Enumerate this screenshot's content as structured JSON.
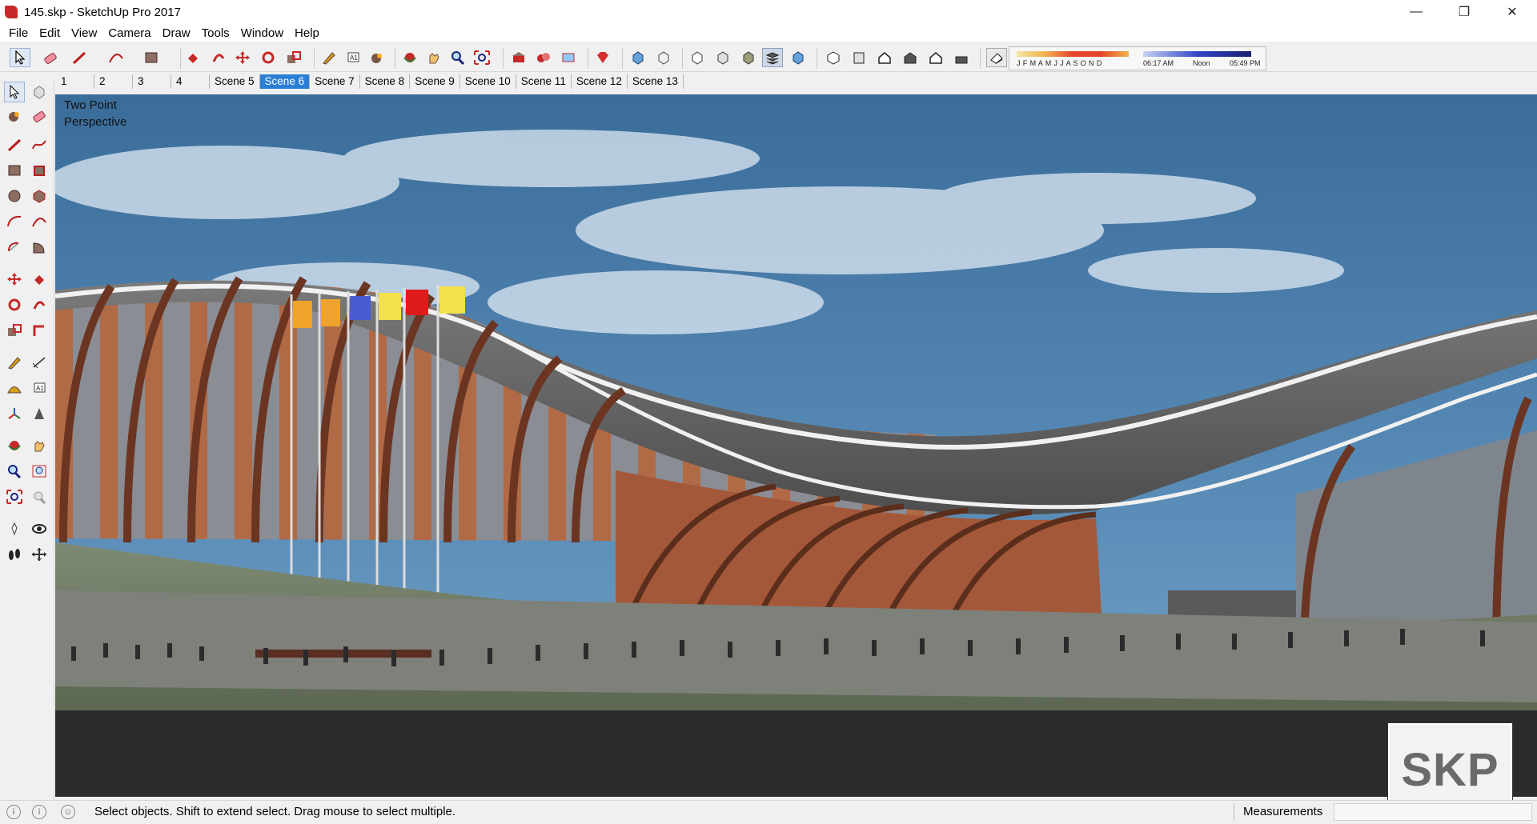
{
  "window": {
    "title": "145.skp - SketchUp Pro 2017",
    "minimize": "—",
    "restore": "❐",
    "close": "✕"
  },
  "menu": [
    "File",
    "Edit",
    "View",
    "Camera",
    "Draw",
    "Tools",
    "Window",
    "Help"
  ],
  "shadow_settings": {
    "months": "J F M A M J J A S O N D",
    "time_start": "06:17 AM",
    "time_mid": "Noon",
    "time_end": "05:49 PM"
  },
  "scenes": {
    "tabs": [
      "1",
      "2",
      "3",
      "4",
      "Scene 5",
      "Scene 6",
      "Scene 7",
      "Scene 8",
      "Scene 9",
      "Scene 10",
      "Scene 11",
      "Scene 12",
      "Scene 13"
    ],
    "active": "Scene 6"
  },
  "viewport": {
    "camera_label_line1": "Two Point",
    "camera_label_line2": "Perspective",
    "watermark": "SKP"
  },
  "status": {
    "hint": "Select objects. Shift to extend select. Drag mouse to select multiple.",
    "measurements_label": "Measurements",
    "measurements_value": ""
  },
  "colors": {
    "sky": "#4d7ea8",
    "roof": "#5f5f5f",
    "brick": "#a85a3a",
    "ground": "#5d6b55",
    "scene_tab_active": "#2a7fd4"
  }
}
